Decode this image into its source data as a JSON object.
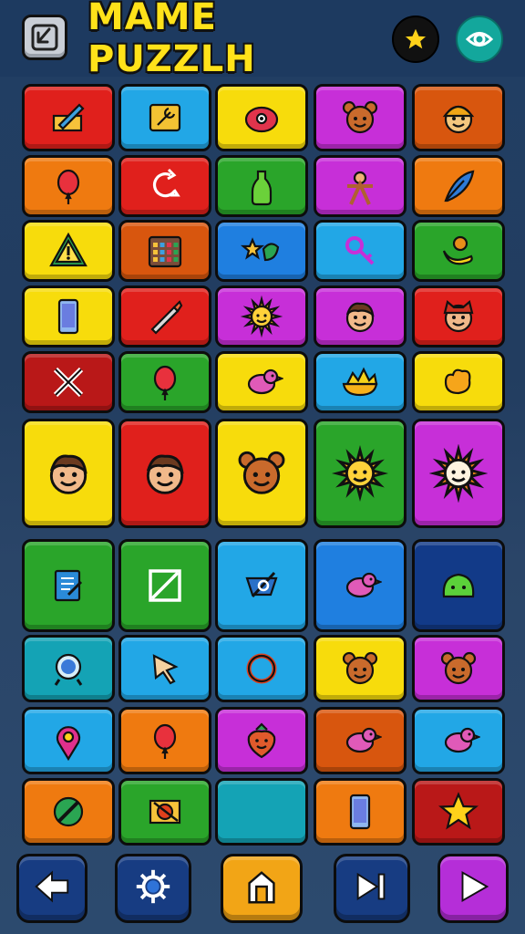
{
  "header": {
    "title": "MAME PUZZLH",
    "back_icon": "back-arrow-icon",
    "star_icon": "star-icon",
    "eye_icon": "eye-icon"
  },
  "colors": {
    "red": "#e0201c",
    "sky": "#22a7e6",
    "yellow": "#f7dc0c",
    "magenta": "#c72fd8",
    "orange": "#ef7a10",
    "green": "#2aa52a",
    "navy": "#123a88",
    "teal": "#14a3b5",
    "darkred": "#b91818",
    "darkorange": "#d8560e",
    "blue": "#1f7fe0"
  },
  "tiles": [
    {
      "color": "red",
      "icon": "pencil-icon"
    },
    {
      "color": "sky",
      "icon": "wrench-board-icon"
    },
    {
      "color": "yellow",
      "icon": "fruit-face-icon"
    },
    {
      "color": "magenta",
      "icon": "bear-face-icon"
    },
    {
      "color": "darkorange",
      "icon": "builder-face-icon"
    },
    {
      "color": "orange",
      "icon": "balloon-icon"
    },
    {
      "color": "red",
      "icon": "arrow-loop-icon"
    },
    {
      "color": "green",
      "icon": "bottle-icon"
    },
    {
      "color": "magenta",
      "icon": "gingerbread-icon"
    },
    {
      "color": "orange",
      "icon": "feather-icon"
    },
    {
      "color": "yellow",
      "icon": "warning-icon"
    },
    {
      "color": "darkorange",
      "icon": "calendar-icon"
    },
    {
      "color": "blue",
      "icon": "star-leaf-icon"
    },
    {
      "color": "sky",
      "icon": "key-icon"
    },
    {
      "color": "green",
      "icon": "banana-icon"
    },
    {
      "color": "yellow",
      "icon": "phone-icon"
    },
    {
      "color": "red",
      "icon": "crayon-icon"
    },
    {
      "color": "magenta",
      "icon": "sun-icon"
    },
    {
      "color": "magenta",
      "icon": "boy-face-icon"
    },
    {
      "color": "red",
      "icon": "cat-face-icon"
    },
    {
      "color": "darkred",
      "icon": "tools-icon"
    },
    {
      "color": "green",
      "icon": "balloon-icon"
    },
    {
      "color": "yellow",
      "icon": "bird-icon"
    },
    {
      "color": "sky",
      "icon": "pie-icon"
    },
    {
      "color": "yellow",
      "icon": "flower-icon"
    },
    {
      "color": "yellow",
      "icon": "boy-face-icon",
      "big": true
    },
    {
      "color": "red",
      "icon": "boy-face-icon",
      "big": true
    },
    {
      "color": "yellow",
      "icon": "bear-face-icon",
      "big": true
    },
    {
      "color": "green",
      "icon": "sun-icon",
      "big": true
    },
    {
      "color": "magenta",
      "icon": "sun-face-icon",
      "big": true
    },
    {
      "color": "green",
      "icon": "notepad-icon"
    },
    {
      "color": "green",
      "icon": "square-slash-icon"
    },
    {
      "color": "sky",
      "icon": "shape-icon"
    },
    {
      "color": "blue",
      "icon": "bird-icon"
    },
    {
      "color": "navy",
      "icon": "slime-icon"
    },
    {
      "color": "teal",
      "icon": "magnifier-icon"
    },
    {
      "color": "sky",
      "icon": "cursor-icon"
    },
    {
      "color": "sky",
      "icon": "ring-icon"
    },
    {
      "color": "yellow",
      "icon": "bear-face-icon"
    },
    {
      "color": "magenta",
      "icon": "bear-face-icon"
    },
    {
      "color": "sky",
      "icon": "location-pin-icon"
    },
    {
      "color": "orange",
      "icon": "balloon-icon"
    },
    {
      "color": "magenta",
      "icon": "strawberry-face-icon"
    },
    {
      "color": "darkorange",
      "icon": "bird-icon"
    },
    {
      "color": "sky",
      "icon": "bird-icon"
    },
    {
      "color": "orange",
      "icon": "no-sign-icon"
    },
    {
      "color": "green",
      "icon": "target-icon"
    },
    {
      "color": "teal",
      "icon": ""
    },
    {
      "color": "orange",
      "icon": "phone-icon"
    },
    {
      "color": "darkred",
      "icon": "star-icon"
    }
  ],
  "bottom_nav": [
    {
      "icon": "left-arrow-icon",
      "color": "#173c82"
    },
    {
      "icon": "gear-icon",
      "color": "#173c82"
    },
    {
      "icon": "home-icon",
      "color": "#f2a516"
    },
    {
      "icon": "skip-icon",
      "color": "#173c82"
    },
    {
      "icon": "play-icon",
      "color": "#b52ed8"
    }
  ]
}
